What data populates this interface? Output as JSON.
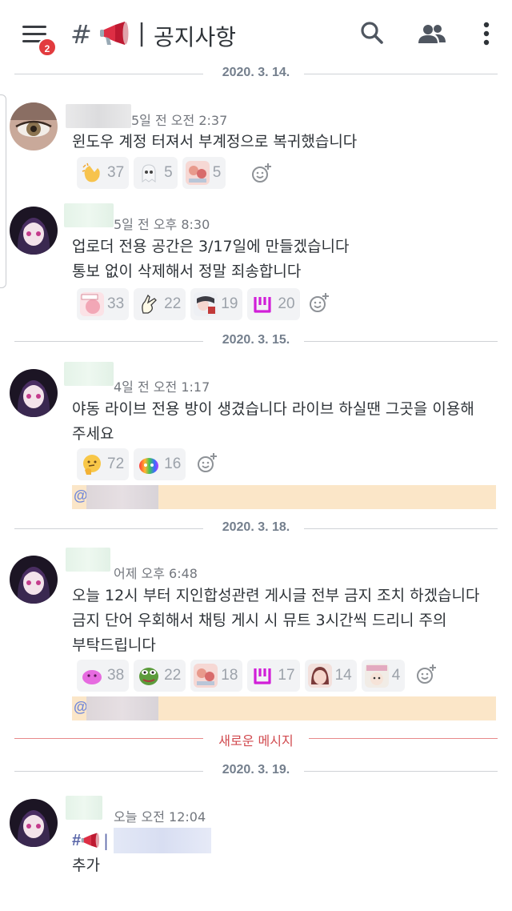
{
  "header": {
    "channel_name": "공지사항",
    "hash_symbol": "#",
    "separator": "|",
    "unread_badge": "2",
    "icons": [
      "menu-icon",
      "megaphone-icon",
      "search-icon",
      "members-icon",
      "more-vertical-icon"
    ]
  },
  "dividers": {
    "d1": "2020. 3. 14.",
    "d2": "2020. 3. 15.",
    "d3": "2020. 3. 18.",
    "new_messages": "새로운 메시지",
    "d4": "2020. 3. 19."
  },
  "messages": [
    {
      "timestamp": "5일 전 오전 2:37",
      "lines": [
        "윈도우 계정 터져서 부계정으로 복귀했습니다"
      ],
      "reactions": [
        {
          "emoji": "clapping-hands",
          "count": "37"
        },
        {
          "emoji": "ghost",
          "count": "5"
        },
        {
          "emoji": "anime-sticker",
          "count": "5"
        }
      ]
    },
    {
      "timestamp": "5일 전 오후 8:30",
      "lines": [
        "업로더 전용 공간은 3/17일에 만들겠습니다",
        "통보 없이 삭제해서 정말 죄송합니다"
      ],
      "reactions": [
        {
          "emoji": "anime-sticker-holy",
          "count": "33"
        },
        {
          "emoji": "drawn-hand",
          "count": "22"
        },
        {
          "emoji": "anime-sticker-2",
          "count": "19"
        },
        {
          "emoji": "purple-bracket",
          "count": "20"
        }
      ]
    },
    {
      "timestamp": "4일 전 오전 1:17",
      "lines": [
        "야동 라이브 전용 방이 생겼습니다 라이브 하실땐 그곳을 이용해",
        "주세요"
      ],
      "reactions": [
        {
          "emoji": "thinking-face",
          "count": "72"
        },
        {
          "emoji": "rainbow-blob",
          "count": "16"
        }
      ],
      "mention": "@"
    },
    {
      "timestamp": "어제 오후 6:48",
      "lines": [
        "오늘 12시 부터 지인합성관련 게시글 전부 금지 조치 하겠습니다",
        "금지 단어 우회해서 채팅 게시 시 뮤트 3시간씩 드리니 주의",
        "부탁드립니다"
      ],
      "reactions": [
        {
          "emoji": "pink-blob",
          "count": "38"
        },
        {
          "emoji": "pepe-frog",
          "count": "22"
        },
        {
          "emoji": "anime-sticker",
          "count": "18"
        },
        {
          "emoji": "purple-bracket",
          "count": "17"
        },
        {
          "emoji": "anime-face",
          "count": "14"
        },
        {
          "emoji": "anime-sticker-3",
          "count": "4"
        }
      ],
      "mention": "@"
    },
    {
      "timestamp": "오늘 오전 12:04",
      "channel_link_hash": "#",
      "channel_link_pipe": "|",
      "lines": [
        "추가"
      ]
    }
  ],
  "colors": {
    "badge": "#e23b3e",
    "mention_bg": "#fbe6c8",
    "new_divider": "#d14a4f",
    "reaction_bg": "#f2f3f5"
  }
}
